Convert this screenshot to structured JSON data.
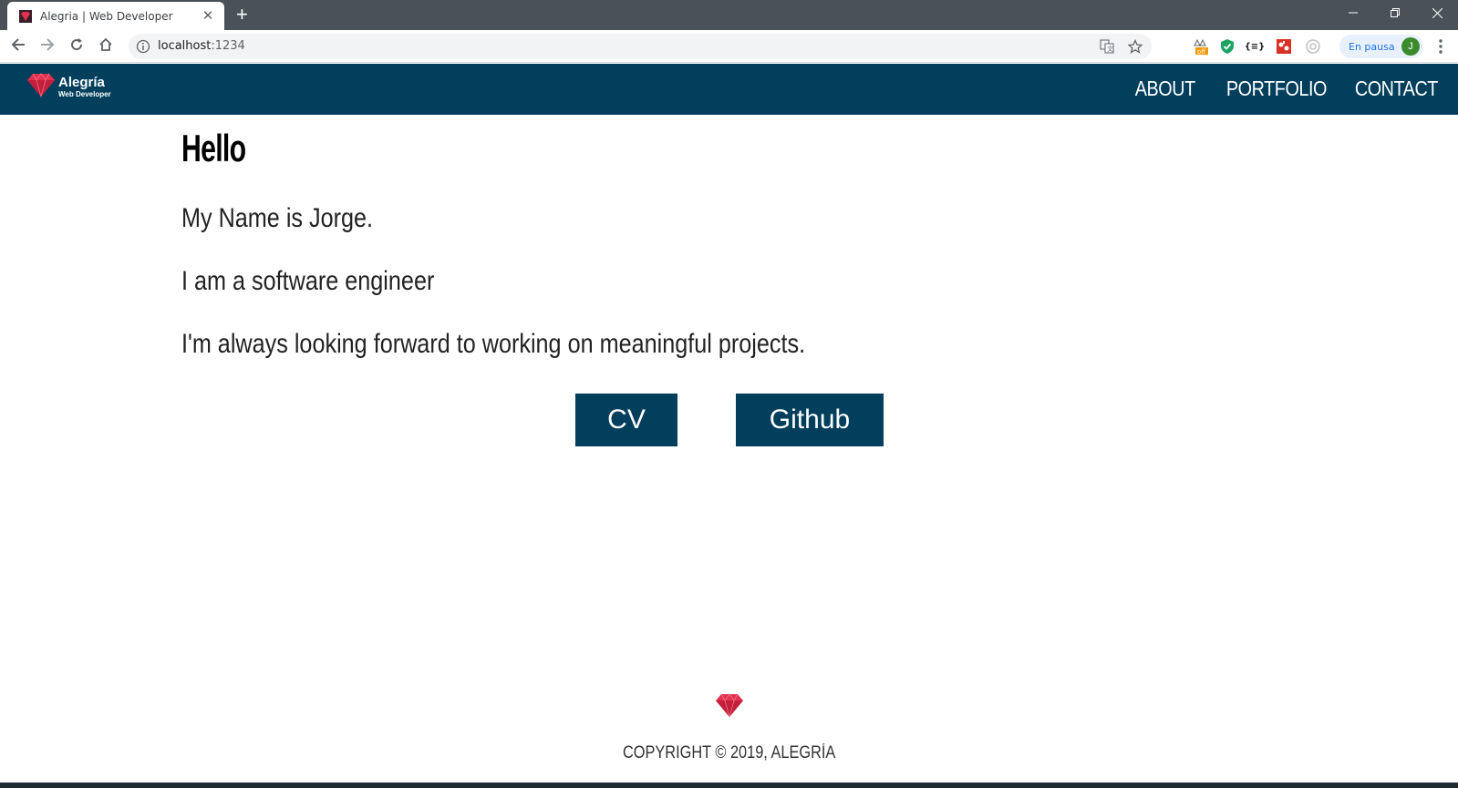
{
  "browser": {
    "tab": {
      "title": "Alegria | Web Developer",
      "close_symbol": "✕",
      "favicon": "gem-icon"
    },
    "new_tab_symbol": "+",
    "window_controls": {
      "minimize": "—",
      "restore": "❐",
      "close": "✕"
    },
    "address_bar": {
      "host": "localhost",
      "port": ":1234"
    },
    "profile": {
      "status": "En pausa",
      "avatar_letter": "J"
    },
    "extensions": [
      "off-badge-icon",
      "shield-check-icon",
      "json-braces-icon",
      "red-puzzle-icon",
      "circle-gray-icon"
    ],
    "extension_labels": {
      "off": "off",
      "json": "{≡}"
    }
  },
  "site": {
    "brand": {
      "name": "Alegría",
      "tagline": "Web Developer"
    },
    "nav": [
      "ABOUT",
      "PORTFOLIO",
      "CONTACT"
    ],
    "heading": "Hello",
    "paragraphs": [
      "My Name is Jorge.",
      "I am a software engineer",
      "I'm always looking forward to working on meaningful projects."
    ],
    "buttons": {
      "cv": "CV",
      "github": "Github"
    },
    "footer": {
      "copyright": "COPYRIGHT © 2019, ALEGRÍA"
    }
  },
  "colors": {
    "header_bg": "#023f5c",
    "button_bg": "#023f5c",
    "gem_red": "#d62f4b"
  }
}
